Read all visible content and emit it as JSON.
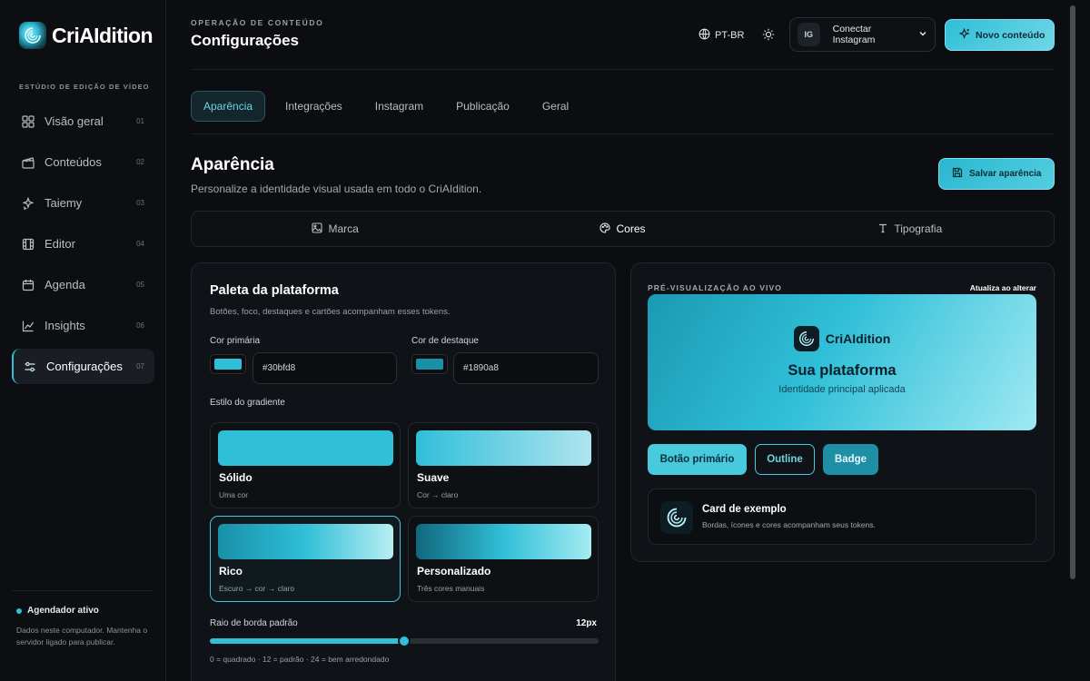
{
  "brand": {
    "name": "CriAIdition"
  },
  "sidebar": {
    "caption": "ESTÚDIO DE EDIÇÃO DE VÍDEO",
    "items": [
      {
        "label": "Visão geral",
        "num": "01",
        "icon": "grid-icon"
      },
      {
        "label": "Conteúdos",
        "num": "02",
        "icon": "clapperboard-icon"
      },
      {
        "label": "Taiemy",
        "num": "03",
        "icon": "sparkles-icon"
      },
      {
        "label": "Editor",
        "num": "04",
        "icon": "film-icon"
      },
      {
        "label": "Agenda",
        "num": "05",
        "icon": "calendar-icon"
      },
      {
        "label": "Insights",
        "num": "06",
        "icon": "chart-line-icon"
      },
      {
        "label": "Configurações",
        "num": "07",
        "icon": "sliders-icon",
        "active": true
      }
    ],
    "scheduler": {
      "title": "Agendador ativo",
      "desc": "Dados neste computador. Mantenha o servidor ligado para publicar."
    }
  },
  "header": {
    "caption": "OPERAÇÃO DE CONTEÚDO",
    "title": "Configurações",
    "lang": "PT-BR",
    "ig_badge": "IG",
    "ig_label": "Conectar Instagram",
    "new_content": "Novo conteúdo"
  },
  "tabs": [
    {
      "label": "Aparência",
      "active": true
    },
    {
      "label": "Integrações"
    },
    {
      "label": "Instagram"
    },
    {
      "label": "Publicação"
    },
    {
      "label": "Geral"
    }
  ],
  "section": {
    "title": "Aparência",
    "subtitle": "Personalize a identidade visual usada em todo o CriAIdition.",
    "save": "Salvar aparência"
  },
  "subtabs": [
    {
      "label": "Marca",
      "icon": "image-icon"
    },
    {
      "label": "Cores",
      "icon": "palette-icon",
      "active": true
    },
    {
      "label": "Tipografia",
      "icon": "type-icon"
    }
  ],
  "palette": {
    "title": "Paleta da plataforma",
    "subtitle": "Botões, foco, destaques e cartões acompanham esses tokens.",
    "primary_label": "Cor primária",
    "primary_value": "#30bfd8",
    "accent_label": "Cor de destaque",
    "accent_value": "#1890a8",
    "gradient_label": "Estilo do gradiente",
    "gradients": [
      {
        "name": "Sólido",
        "desc": "Uma cor"
      },
      {
        "name": "Suave",
        "desc": "Cor → claro"
      },
      {
        "name": "Rico",
        "desc": "Escuro → cor → claro",
        "active": true
      },
      {
        "name": "Personalizado",
        "desc": "Três cores manuais"
      }
    ],
    "radius_label": "Raio de borda padrão",
    "radius_value": "12px",
    "radius_fraction": 0.5,
    "radius_hint": "0 = quadrado · 12 = padrão · 24 = bem arredondado"
  },
  "preview": {
    "caption": "PRÉ-VISUALIZAÇÃO AO VIVO",
    "live": "Atualiza ao alterar",
    "brand": "CriAIdition",
    "title": "Sua plataforma",
    "subtitle": "Identidade principal aplicada",
    "btn_primary": "Botão primário",
    "btn_outline": "Outline",
    "btn_badge": "Badge",
    "card_title": "Card de exemplo",
    "card_desc": "Bordas, ícones e cores acompanham seus tokens."
  },
  "colors": {
    "primary": "#30bfd8",
    "accent": "#1890a8"
  }
}
